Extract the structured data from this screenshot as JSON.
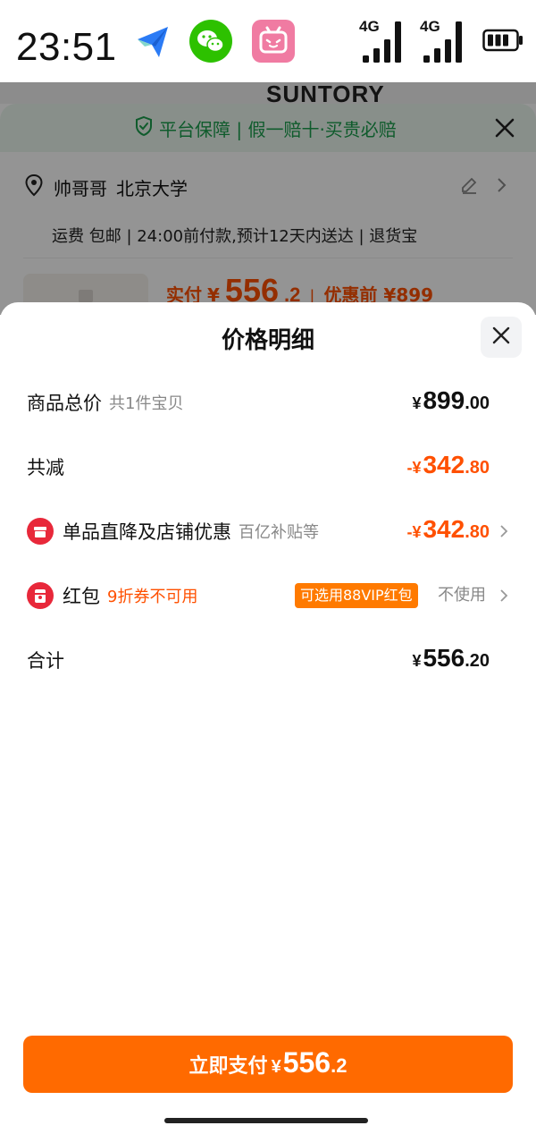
{
  "status_bar": {
    "time": "23:51",
    "signal_1_label": "4G",
    "signal_2_label": "4G",
    "apps": [
      "feishu-plane-icon",
      "wechat-icon",
      "bilibili-icon"
    ]
  },
  "background": {
    "brand_text": "SUNTORY",
    "guarantee_text": "平台保障 | 假一赔十·买贵必赔",
    "address_name": "帅哥哥",
    "address_place": "北京大学",
    "shipping_info": "运费 包邮 | 24:00前付款,预计12天内送达 | 退货宝",
    "pay_label": "实付",
    "pay_currency": "¥",
    "pay_int": "556",
    "pay_dec": ".2",
    "pay_separator": "|",
    "pay_before": "优惠前 ¥899"
  },
  "sheet": {
    "title": "价格明细",
    "rows": {
      "total": {
        "label": "商品总价",
        "sub": "共1件宝贝",
        "currency": "¥",
        "int": "899",
        "dec": ".00"
      },
      "reduce": {
        "label": "共减",
        "currency": "-¥",
        "int": "342",
        "dec": ".80"
      },
      "discount": {
        "label": "单品直降及店铺优惠",
        "sub": "百亿补贴等",
        "currency": "-¥",
        "int": "342",
        "dec": ".80"
      },
      "redpacket": {
        "label": "红包",
        "warn": "9折券不可用",
        "tag": "可选用88VIP红包",
        "action": "不使用"
      },
      "sum": {
        "label": "合计",
        "currency": "¥",
        "int": "556",
        "dec": ".20"
      }
    },
    "pay_button": {
      "label": "立即支付",
      "currency": "¥",
      "int": "556",
      "dec": ".2"
    }
  },
  "colors": {
    "accent": "#ff5000",
    "button": "#ff6a00",
    "guarantee": "#1b9e4c",
    "red_icon": "#e8283a"
  }
}
